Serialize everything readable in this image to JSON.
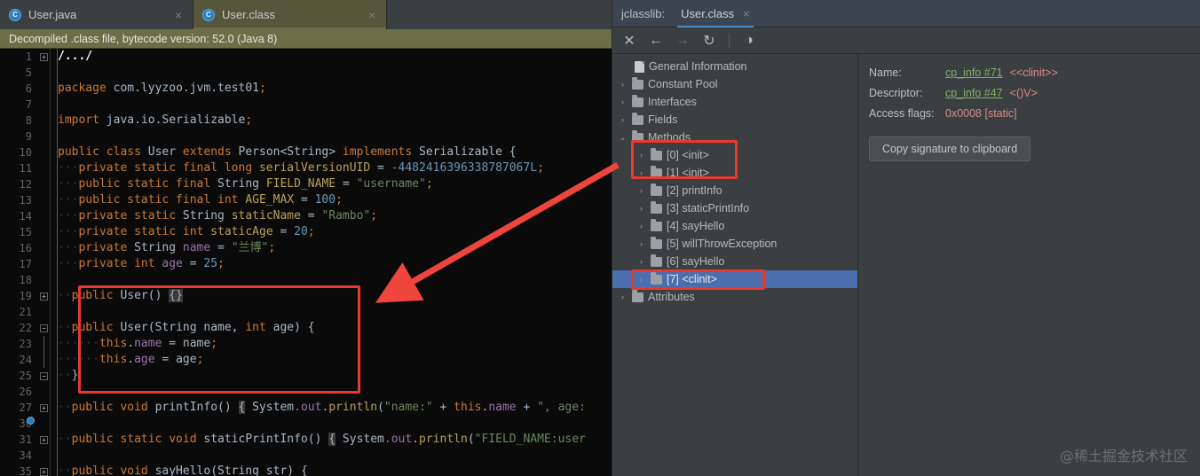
{
  "editor": {
    "tabs": [
      {
        "label": "User.java",
        "icon": "java-class-icon",
        "close": "×",
        "active": false
      },
      {
        "label": "User.class",
        "icon": "java-class-icon",
        "close": "×",
        "active": true
      }
    ],
    "notice": "Decompiled .class file, bytecode version: 52.0 (Java 8)",
    "lines": [
      {
        "num": "1",
        "fold": "plus"
      },
      {
        "num": "5",
        "fold": ""
      },
      {
        "num": "6",
        "fold": ""
      },
      {
        "num": "7",
        "fold": ""
      },
      {
        "num": "8",
        "fold": ""
      },
      {
        "num": "9",
        "fold": ""
      },
      {
        "num": "10",
        "fold": ""
      },
      {
        "num": "11",
        "fold": ""
      },
      {
        "num": "12",
        "fold": ""
      },
      {
        "num": "13",
        "fold": ""
      },
      {
        "num": "14",
        "fold": ""
      },
      {
        "num": "15",
        "fold": ""
      },
      {
        "num": "16",
        "fold": ""
      },
      {
        "num": "17",
        "fold": ""
      },
      {
        "num": "18",
        "fold": ""
      },
      {
        "num": "19",
        "fold": "plus"
      },
      {
        "num": "21",
        "fold": ""
      },
      {
        "num": "22",
        "fold": "minus-top"
      },
      {
        "num": "23",
        "fold": "bar"
      },
      {
        "num": "24",
        "fold": "bar"
      },
      {
        "num": "25",
        "fold": "minus-bot"
      },
      {
        "num": "26",
        "fold": ""
      },
      {
        "num": "27",
        "fold": "plus"
      },
      {
        "num": "30",
        "fold": ""
      },
      {
        "num": "31",
        "fold": "plus"
      },
      {
        "num": "34",
        "fold": ""
      },
      {
        "num": "35",
        "fold": "plus"
      }
    ],
    "code_text": {
      "l1": "/.../",
      "l6": "package com.lyyzoo.jvm.test01;",
      "l8": "import java.io.Serializable;",
      "l10": "public class User extends Person<String> implements Serializable {",
      "l11": "private static final long serialVersionUID = -4482416396338787067L;",
      "l12": "public static final String FIELD_NAME = \"username\";",
      "l13": "public static final int AGE_MAX = 100;",
      "l14": "private static String staticName = \"Rambo\";",
      "l15": "private static int staticAge = 20;",
      "l16": "private String name = \"兰博\";",
      "l17": "private int age = 25;",
      "l19": "public User() {}",
      "l22": "public User(String name, int age) {",
      "l23": "this.name = name;",
      "l24": "this.age = age;",
      "l25": "}",
      "l27": "public void printInfo() { System.out.println(\"name:\" + this.name + \", age:",
      "l31": "public static void staticPrintInfo() { System.out.println(\"FIELD_NAME:user",
      "l35": "public void sayHello(String str) {"
    }
  },
  "jclasslib": {
    "panel_title": "jclasslib:",
    "tab": {
      "label": "User.class",
      "close": "×"
    },
    "toolbar": [
      {
        "name": "close-icon",
        "glyph": "✕",
        "enabled": true
      },
      {
        "name": "back-icon",
        "glyph": "←",
        "enabled": true
      },
      {
        "name": "forward-icon",
        "glyph": "→",
        "enabled": false
      },
      {
        "name": "reload-icon",
        "glyph": "↻",
        "enabled": true
      },
      {
        "name": "browse-icon",
        "glyph": "◑",
        "enabled": true
      }
    ],
    "tree": [
      {
        "label": "General Information",
        "icon": "file",
        "twist": "",
        "indent": 14,
        "selected": false
      },
      {
        "label": "Constant Pool",
        "icon": "folder",
        "twist": "›",
        "indent": 0,
        "selected": false
      },
      {
        "label": "Interfaces",
        "icon": "folder",
        "twist": "›",
        "indent": 0,
        "selected": false
      },
      {
        "label": "Fields",
        "icon": "folder",
        "twist": "›",
        "indent": 0,
        "selected": false
      },
      {
        "label": "Methods",
        "icon": "folder",
        "twist": "⌄",
        "indent": 0,
        "selected": false
      },
      {
        "label": "[0] <init>",
        "icon": "folder",
        "twist": "›",
        "indent": 16,
        "selected": false
      },
      {
        "label": "[1] <init>",
        "icon": "folder",
        "twist": "›",
        "indent": 16,
        "selected": false
      },
      {
        "label": "[2] printInfo",
        "icon": "folder",
        "twist": "›",
        "indent": 16,
        "selected": false
      },
      {
        "label": "[3] staticPrintInfo",
        "icon": "folder",
        "twist": "›",
        "indent": 16,
        "selected": false
      },
      {
        "label": "[4] sayHello",
        "icon": "folder",
        "twist": "›",
        "indent": 16,
        "selected": false
      },
      {
        "label": "[5] willThrowException",
        "icon": "folder",
        "twist": "›",
        "indent": 16,
        "selected": false
      },
      {
        "label": "[6] sayHello",
        "icon": "folder",
        "twist": "›",
        "indent": 16,
        "selected": false
      },
      {
        "label": "[7] <clinit>",
        "icon": "folder",
        "twist": "›",
        "indent": 16,
        "selected": true
      },
      {
        "label": "Attributes",
        "icon": "folder",
        "twist": "›",
        "indent": 0,
        "selected": false
      }
    ],
    "detail": {
      "name_label": "Name:",
      "name_link": "cp_info #71",
      "name_value": "<<clinit>>",
      "descriptor_label": "Descriptor:",
      "descriptor_link": "cp_info #47",
      "descriptor_value": "<()V>",
      "flags_label": "Access flags:",
      "flags_value": "0x0008 [static]",
      "copy_button": "Copy signature to clipboard"
    }
  },
  "watermark": "@稀土掘金技术社区",
  "colors": {
    "annotation_red": "#e8392f",
    "selection_blue": "#4b6eaf",
    "notice_olive": "#6c6e48",
    "tab_active": "#55563a"
  }
}
